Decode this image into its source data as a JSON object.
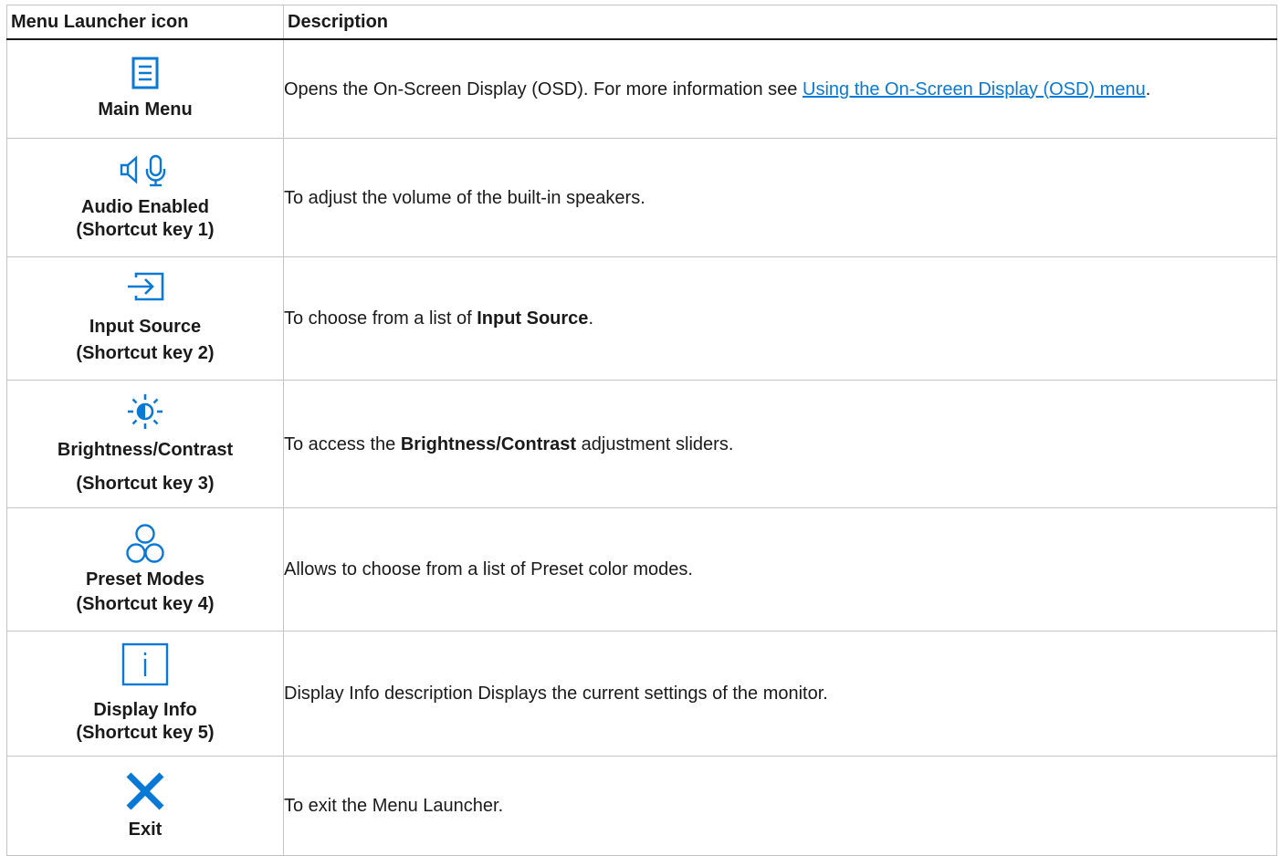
{
  "table": {
    "header": {
      "col1": "Menu Launcher icon",
      "col2": "Description"
    },
    "rows": [
      {
        "icon": "main-menu-icon",
        "name_line1": "Main Menu",
        "name_line2": "",
        "desc_text": "Opens the On-Screen Display (OSD). For more information see ",
        "desc_link": "Using the On-Screen Display (OSD) menu",
        "desc_after": "."
      },
      {
        "icon": "speaker-microphone-icon",
        "name_line1": "Audio Enabled",
        "name_line2": "(Shortcut key 1)",
        "desc_text": "To adjust the volume of the built-in speakers."
      },
      {
        "icon": "input-source-icon",
        "name_line1": "Input Source",
        "name_line2": "(Shortcut key 2)",
        "desc_before": "To choose from a list of ",
        "desc_bold": "Input Source",
        "desc_after": "."
      },
      {
        "icon": "brightness-contrast-icon",
        "name_line1": "Brightness/Contrast",
        "name_line2": "(Shortcut key 3)",
        "desc_before": "To access the ",
        "desc_bold": "Brightness/Contrast",
        "desc_after": " adjustment sliders."
      },
      {
        "icon": "preset-modes-icon",
        "name_line1": "Preset Modes",
        "name_line2": "(Shortcut key 4)",
        "desc_text": "Allows to choose from a list of Preset color modes."
      },
      {
        "icon": "display-info-icon",
        "name_line1": "Display Info",
        "name_line2": "(Shortcut key 5)",
        "desc_text": "Display Info description Displays the current settings of the monitor."
      },
      {
        "icon": "exit-icon",
        "name_line1": "Exit",
        "name_line2": "",
        "desc_text": "To exit the Menu Launcher."
      }
    ]
  },
  "colors": {
    "icon_blue": "#0a79d6",
    "link_blue": "#0a79d6",
    "text": "#1a1a1a",
    "border": "#c4c4c4"
  }
}
